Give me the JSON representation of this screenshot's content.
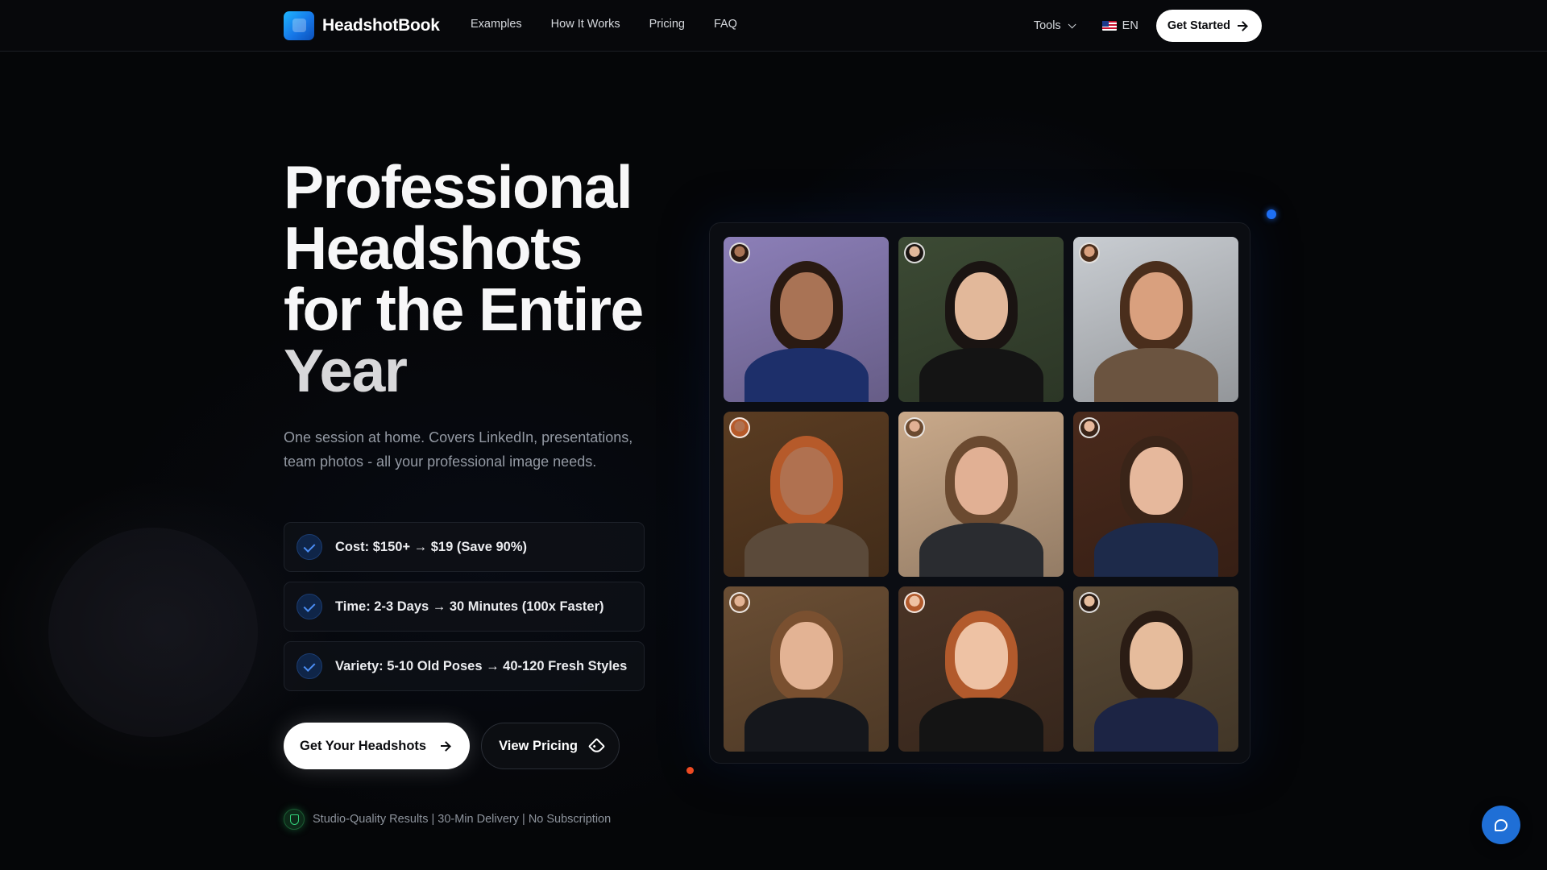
{
  "brand": {
    "name": "HeadshotBook"
  },
  "nav": {
    "links": [
      "Examples",
      "How It Works",
      "Pricing",
      "FAQ"
    ],
    "tools_label": "Tools",
    "language": "EN",
    "cta_label": "Get Started"
  },
  "hero": {
    "title_lines": [
      "Professional",
      "Headshots",
      "for the Entire",
      "Year"
    ],
    "subtitle": "One session at home. Covers LinkedIn, presentations, team photos - all your professional image needs.",
    "features": [
      "Cost: $150+ → $19 (Save 90%)",
      "Time: 2-3 Days → 30 Minutes (100x Faster)",
      "Variety: 5-10 Old Poses → 40-120 Fresh Styles"
    ],
    "primary_cta": "Get Your Headshots",
    "secondary_cta": "View Pricing",
    "trust_line": "Studio-Quality Results | 30-Min Delivery | No Subscription"
  },
  "gallery": {
    "photos": [
      {
        "bg": "#8c7fb8",
        "skin": "#a97355",
        "hair": "#2a1a12",
        "cloth": "#1d2f6a"
      },
      {
        "bg": "#3c4a34",
        "skin": "#e2b89a",
        "hair": "#1a1412",
        "cloth": "#141414"
      },
      {
        "bg": "#c9cdd2",
        "skin": "#d9a07e",
        "hair": "#4a2e1c",
        "cloth": "#6b5440"
      },
      {
        "bg": "#5a3c22",
        "skin": "#b07150",
        "hair": "#b65a2a",
        "cloth": "#5b4a3a"
      },
      {
        "bg": "#c9a98a",
        "skin": "#e1b094",
        "hair": "#6b4a30",
        "cloth": "#2a2c30"
      },
      {
        "bg": "#4a2a1c",
        "skin": "#e6b89c",
        "hair": "#3a2418",
        "cloth": "#1d2a4a"
      },
      {
        "bg": "#6a4e34",
        "skin": "#e3b394",
        "hair": "#7a5030",
        "cloth": "#15171c"
      },
      {
        "bg": "#4a3426",
        "skin": "#eec2a4",
        "hair": "#b25a2c",
        "cloth": "#141414"
      },
      {
        "bg": "#5a4a36",
        "skin": "#e6bc9c",
        "hair": "#2a1c14",
        "cloth": "#1c2444"
      }
    ]
  },
  "colors": {
    "accent": "#1f6fd6",
    "check": "#4b8ef5",
    "trust_green": "#33d17a",
    "background": "#050608"
  }
}
